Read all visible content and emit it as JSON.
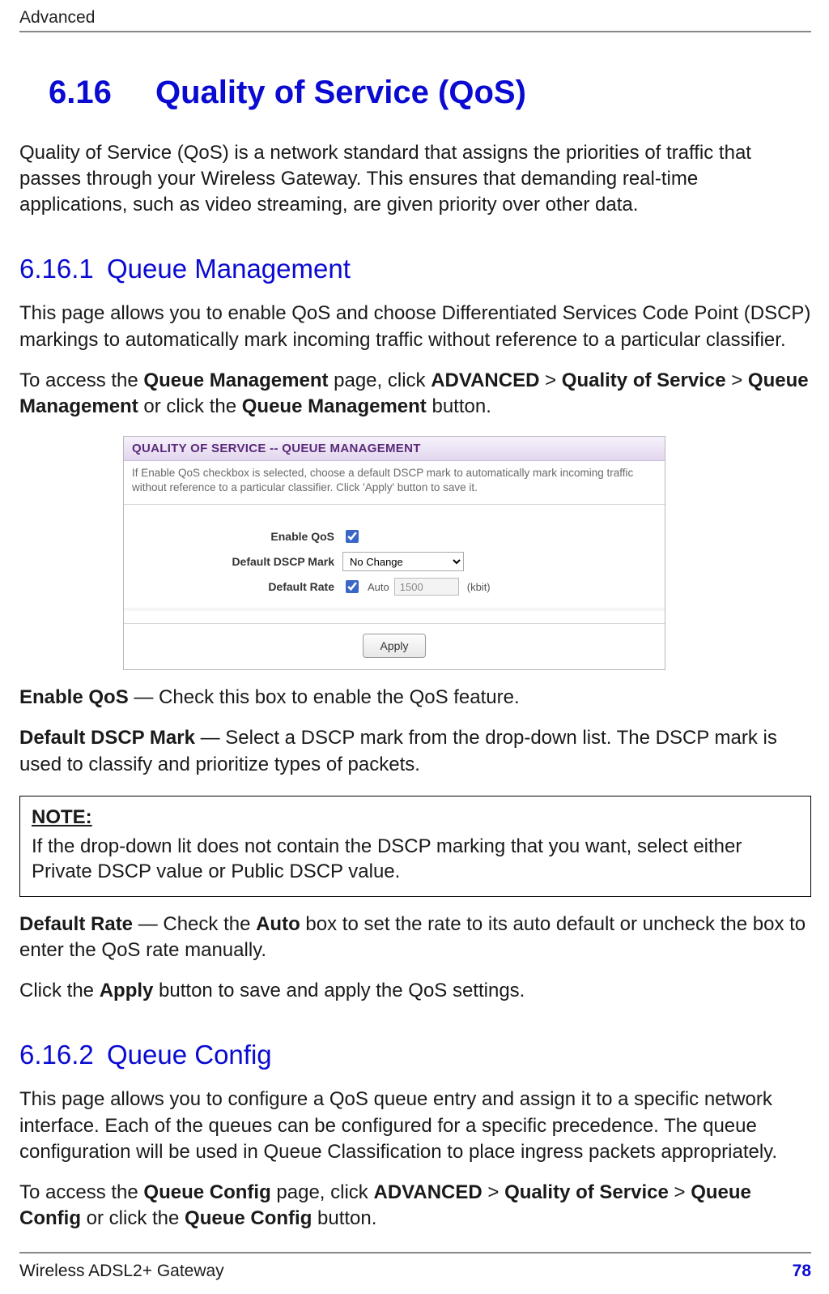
{
  "header": {
    "section": "Advanced"
  },
  "title": {
    "number": "6.16",
    "text": "Quality of Service (QoS)"
  },
  "intro": "Quality of Service (QoS) is a network standard that assigns the priorities of traffic that passes through your Wireless Gateway. This ensures that demanding real-time applications, such as video streaming, are given priority over other data.",
  "s1": {
    "number": "6.16.1",
    "title": "Queue Management",
    "p1": "This page allows you to enable QoS and choose Differentiated Services Code Point (DSCP) markings to automatically mark incoming traffic without reference to a particular classifier.",
    "nav_lead": "To access the ",
    "nav_b1": "Queue Management",
    "nav_mid1": " page, click ",
    "nav_b2": "ADVANCED",
    "nav_sep": " > ",
    "nav_b3": "Quality of Service",
    "nav_b4": "Queue Management",
    "nav_mid2": " or click the ",
    "nav_b5": "Queue Management",
    "nav_tail": " button.",
    "shot": {
      "bar": "QUALITY OF SERVICE -- QUEUE MANAGEMENT",
      "desc": "If Enable QoS checkbox is selected, choose a default DSCP mark to automatically mark incoming traffic without reference to a particular classifier. Click 'Apply' button to save it.",
      "enable_label": "Enable QoS",
      "dscp_label": "Default DSCP Mark",
      "dscp_value": "No Change",
      "rate_label": "Default Rate",
      "rate_auto": "Auto",
      "rate_value": "1500",
      "rate_unit": "(kbit)",
      "apply": "Apply"
    },
    "opt_enable_b": "Enable QoS",
    "opt_enable_t": " — Check this box to enable the QoS feature.",
    "opt_dscp_b": "Default DSCP Mark",
    "opt_dscp_t": " — Select a DSCP mark from the drop-down list. The DSCP mark is used to classify and prioritize types of packets.",
    "note_label": "NOTE:",
    "note_body": "If the drop-down lit does not contain the DSCP marking that you want, select either Private DSCP value or Public DSCP value.",
    "opt_rate_b": "Default Rate",
    "opt_rate_t1": " — Check the ",
    "opt_rate_b2": "Auto",
    "opt_rate_t2": " box to set the rate to its auto default or uncheck the box to enter the QoS rate manually.",
    "apply_t1": "Click the ",
    "apply_b": "Apply",
    "apply_t2": " button to save and apply the QoS settings."
  },
  "s2": {
    "number": "6.16.2",
    "title": "Queue Config",
    "p1": "This page allows you to configure a QoS queue entry and assign it to a specific network interface. Each of the queues can be configured for a specific precedence. The queue configuration will be used in Queue Classification to place ingress packets appropriately.",
    "nav_lead": "To access the ",
    "nav_b1": "Queue Config",
    "nav_mid1": " page, click ",
    "nav_b2": "ADVANCED",
    "nav_sep": " > ",
    "nav_b3": "Quality of Service",
    "nav_b4": "Queue Config",
    "nav_mid2": " or click the ",
    "nav_b5": "Queue Config",
    "nav_tail": " button."
  },
  "footer": {
    "product": "Wireless ADSL2+ Gateway",
    "page": "78"
  }
}
